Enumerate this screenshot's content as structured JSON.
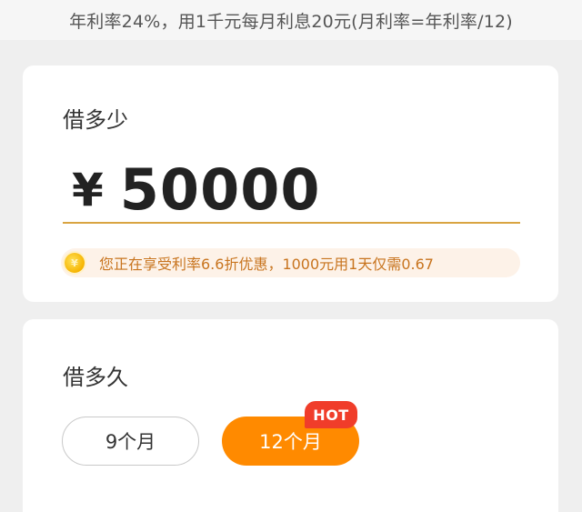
{
  "banner": {
    "text": "年利率24%，用1千元每月利息20元(月利率=年利率/12)"
  },
  "amount_section": {
    "title": "借多少",
    "currency": "¥",
    "value": "50000",
    "promo_text": "您正在享受利率6.6折优惠，1000元用1天仅需0.67"
  },
  "term_section": {
    "title": "借多久",
    "options": [
      {
        "label": "9个月",
        "selected": false
      },
      {
        "label": "12个月",
        "selected": true
      }
    ],
    "hot_badge": "HOT"
  },
  "colors": {
    "accent": "#ff8a00",
    "hot": "#f03d2a",
    "underline": "#d9a441",
    "promo_text": "#c8741e",
    "promo_bg": "#fdf2e8"
  }
}
